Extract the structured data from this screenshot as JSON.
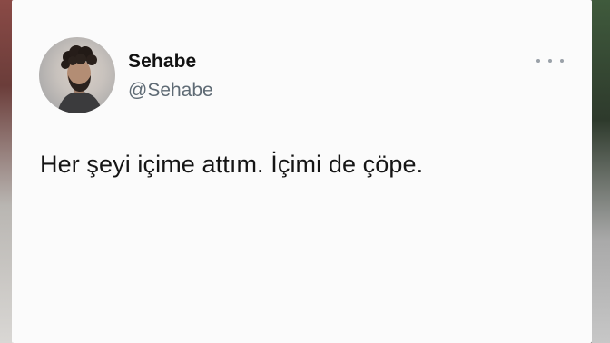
{
  "tweet": {
    "author_name": "Sehabe",
    "author_handle": "@Sehabe",
    "text": "Her şeyi içime attım. İçimi de çöpe.",
    "avatar_icon": "profile-photo",
    "more_icon": "more-options-icon"
  },
  "colors": {
    "card_background": "#fbfbfb",
    "name_text": "#111111",
    "handle_text": "#5f6b75",
    "more_icon": "#9aa1a8"
  }
}
